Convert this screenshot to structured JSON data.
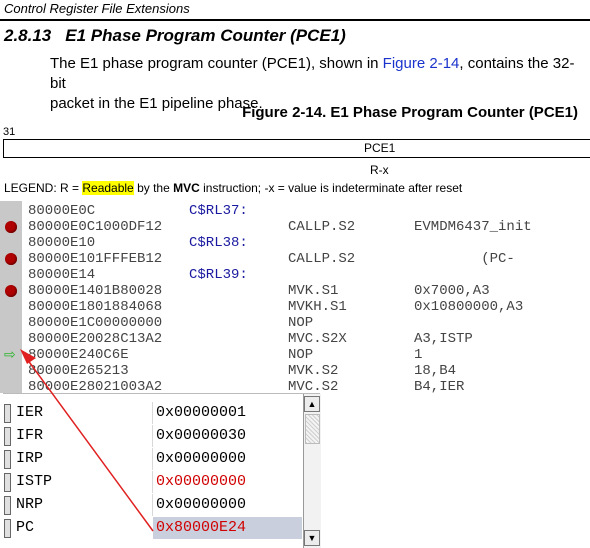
{
  "doc": {
    "header": "Control Register File Extensions",
    "section_number": "2.8.13",
    "section_title": "E1 Phase Program Counter (PCE1)",
    "para_line1_pre": "The E1 phase program counter (PCE1), shown in ",
    "para_link": "Figure 2-14",
    "para_line1_post": ", contains the 32-bit",
    "para_line2": "packet in the E1 pipeline phase.",
    "figure_title": "Figure 2-14. E1 Phase Program Counter (PCE1)",
    "bit_label": "31",
    "register_name": "PCE1",
    "access": "R-x",
    "legend_pre": "LEGEND: R = ",
    "legend_highlight": "Readable",
    "legend_mid": " by the ",
    "legend_bold": "MVC",
    "legend_post": " instruction; -x = value is indeterminate after reset"
  },
  "disasm": {
    "lines": [
      {
        "addr": "80000E0C",
        "op": "",
        "mn": "",
        "args": "",
        "label": "C$RL37:"
      },
      {
        "addr": "80000E0C",
        "op": "1000DF12",
        "mn": "CALLP.S2",
        "args": "EVMDM6437_init"
      },
      {
        "addr": "80000E10",
        "op": "",
        "mn": "",
        "args": "",
        "label": "C$RL38:"
      },
      {
        "addr": "80000E10",
        "op": "1FFFEB12",
        "mn": "CALLP.S2",
        "args": "        (PC-"
      },
      {
        "addr": "80000E14",
        "op": "",
        "mn": "",
        "args": "",
        "label": "C$RL39:"
      },
      {
        "addr": "80000E14",
        "op": "01B80028",
        "mn": "MVK.S1",
        "args": "0x7000,A3"
      },
      {
        "addr": "80000E18",
        "op": "01884068",
        "mn": "MVKH.S1",
        "args": "0x10800000,A3"
      },
      {
        "addr": "80000E1C",
        "op": "00000000",
        "mn": "NOP",
        "args": ""
      },
      {
        "addr": "80000E20",
        "op": "028C13A2",
        "mn": "MVC.S2X",
        "args": "A3,ISTP"
      },
      {
        "addr": "80000E24",
        "op": "0C6E",
        "mn": "NOP",
        "args": "1"
      },
      {
        "addr": "80000E26",
        "op": "5213",
        "mn": "MVK.S2",
        "args": "18,B4"
      },
      {
        "addr": "80000E28",
        "op": "021003A2",
        "mn": "MVC.S2",
        "args": "B4,IER"
      }
    ]
  },
  "registers": [
    {
      "name": "IER",
      "value": "0x00000001"
    },
    {
      "name": "IFR",
      "value": "0x00000030"
    },
    {
      "name": "IRP",
      "value": "0x00000000"
    },
    {
      "name": "ISTP",
      "value": "0x00000000"
    },
    {
      "name": "NRP",
      "value": "0x00000000"
    },
    {
      "name": "PC",
      "value": "0x80000E24"
    }
  ],
  "colors": {
    "breakpoint": "#b00000",
    "pc_arrow": "#2bb52b",
    "changed_value": "#d00000",
    "selected_row": "#c9cfdc",
    "annotation_arrow": "#e02020"
  }
}
